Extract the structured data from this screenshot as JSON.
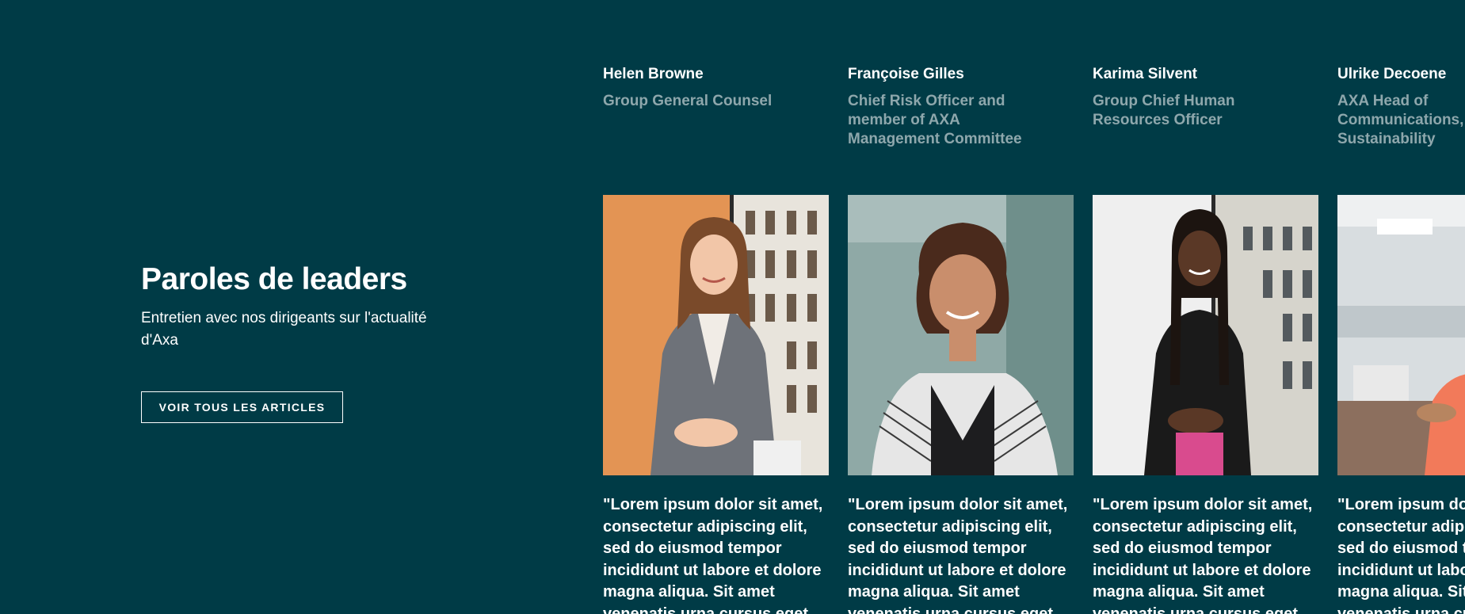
{
  "intro": {
    "title": "Paroles de leaders",
    "subtitle": "Entretien avec nos dirigeants sur l'actualité d'Axa",
    "cta_label": "VOIR TOUS LES ARTICLES"
  },
  "leaders": [
    {
      "name": "Helen Browne",
      "role": "Group General Counsel",
      "quote": "\"Lorem ipsum dolor sit amet, consectetur adipiscing elit, sed do eiusmod tempor incididunt ut labore et dolore magna aliqua. Sit amet venenatis urna cursus eget"
    },
    {
      "name": "Françoise Gilles",
      "role": "Chief Risk Officer and member of AXA Management Committee",
      "quote": "\"Lorem ipsum dolor sit amet, consectetur adipiscing elit, sed do eiusmod tempor incididunt ut labore et dolore magna aliqua. Sit amet venenatis urna cursus eget"
    },
    {
      "name": "Karima Silvent",
      "role": "Group Chief Human Resources Officer",
      "quote": "\"Lorem ipsum dolor sit amet, consectetur adipiscing elit, sed do eiusmod tempor incididunt ut labore et dolore magna aliqua. Sit amet venenatis urna cursus eget"
    },
    {
      "name": "Ulrike Decoene",
      "role": "AXA Head of Communications, Sustainability",
      "quote": "\"Lorem ipsum dolor sit amet, consectetur adipiscing elit, sed do eiusmod tempor incididunt ut labore et dolore magna aliqua. Sit amet venenatis urna cursus eget"
    }
  ],
  "colors": {
    "background": "#003b46",
    "text": "#ffffff",
    "role_text": "#8ea7ac"
  }
}
